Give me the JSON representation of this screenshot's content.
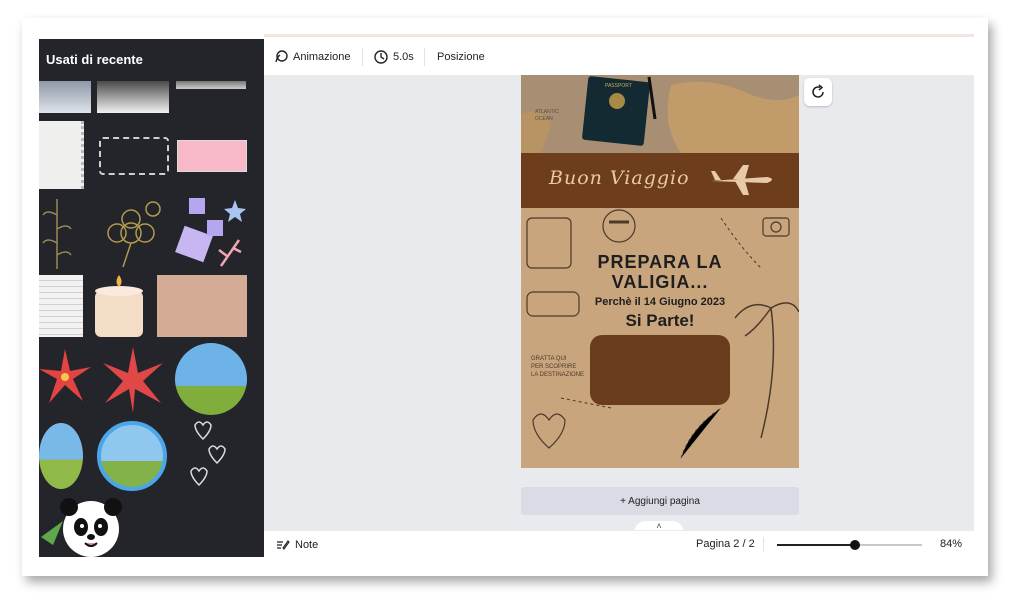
{
  "sidebar": {
    "title": "Usati di recente"
  },
  "toolbar": {
    "animation_label": "Animazione",
    "duration_label": "5.0s",
    "position_label": "Posizione"
  },
  "design": {
    "banner_text": "Buon Viaggio",
    "headline_line1": "PREPARA LA",
    "headline_line2": "VALIGIA...",
    "subline": "Perchè il 14 Giugno 2023",
    "tagline": "Si Parte!",
    "scratch_text": [
      "GRATTA QUI",
      "PER SCOPRIRE",
      "LA DESTINAZIONE"
    ],
    "passport_text": "PASSPORT",
    "map_text": [
      "ATLANTIC",
      "OCEAN"
    ]
  },
  "canvas": {
    "add_page_label": "+ Aggiungi pagina"
  },
  "bottombar": {
    "notes_label": "Note",
    "page_indicator": "Pagina 2 / 2",
    "zoom_label": "84%",
    "zoom_fraction": 0.54
  },
  "colors": {
    "sidebar_bg": "#23252b",
    "canvas_bg": "#e9eaee",
    "banner_brown": "#6e3d1c",
    "parchment": "#c9a57e"
  },
  "icons": [
    "animation-icon",
    "clock-icon",
    "refresh-icon",
    "notes-icon",
    "chevron-left-icon",
    "chevron-up-icon",
    "plane-icon"
  ]
}
